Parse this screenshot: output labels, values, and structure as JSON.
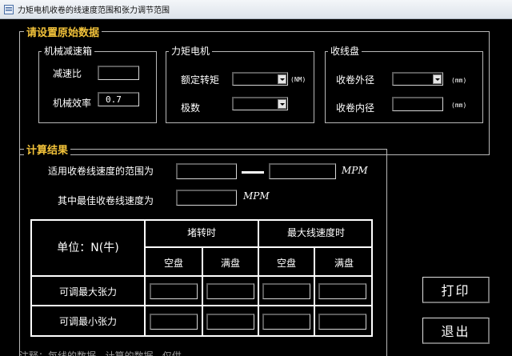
{
  "window": {
    "title": "力矩电机收卷的线速度范围和张力调节范围"
  },
  "original_data": {
    "title": "请设置原始数据",
    "gearbox": {
      "title": "机械减速箱",
      "reduction_ratio_label": "减速比",
      "reduction_ratio_value": "",
      "efficiency_label": "机械效率",
      "efficiency_value": "0.7"
    },
    "torque_motor": {
      "title": "力矩电机",
      "rated_torque_label": "额定转矩",
      "rated_torque_value": "",
      "rated_torque_unit": "(NM)",
      "poles_label": "极数",
      "poles_value": ""
    },
    "reel": {
      "title": "收线盘",
      "outer_diameter_label": "收卷外径",
      "outer_diameter_value": "",
      "outer_diameter_unit": "(mm)",
      "inner_diameter_label": "收卷内径",
      "inner_diameter_value": "",
      "inner_diameter_unit": "(mm)"
    }
  },
  "results": {
    "title": "计算结果",
    "speed_range_label": "适用收卷线速度的范围为",
    "speed_min_value": "",
    "speed_max_value": "",
    "speed_unit": "MPM",
    "best_speed_label": "其中最佳收卷线速度为",
    "best_speed_value": "",
    "best_speed_unit": "MPM",
    "table": {
      "unit_header": "单位：N(牛)",
      "group_stall": "堵转时",
      "group_max_speed": "最大线速度时",
      "col_empty": "空盘",
      "col_full": "满盘",
      "row_max": "可调最大张力",
      "row_min": "可调最小张力",
      "values": [
        [
          "",
          "",
          "",
          ""
        ],
        [
          "",
          "",
          "",
          ""
        ]
      ]
    }
  },
  "buttons": {
    "print": "打印",
    "exit": "退出"
  },
  "footer_clipped_text": "注释：每线的数据...计算的数据...仅供..."
}
